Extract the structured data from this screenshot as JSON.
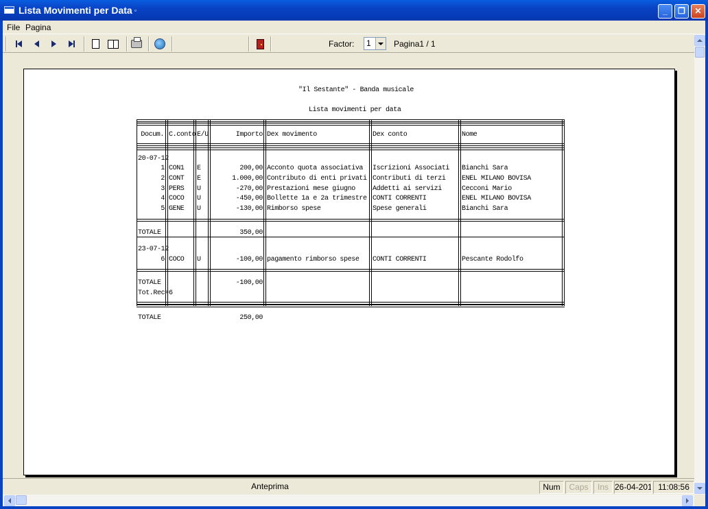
{
  "window": {
    "title": "Lista Movimenti per Data",
    "title_mark": "▫",
    "buttons": {
      "minimize": "_",
      "maximize": "❐",
      "close": "✕"
    }
  },
  "menu": {
    "items": [
      "File",
      "Pagina"
    ]
  },
  "toolbar": {
    "icons": [
      "first-page-icon",
      "previous-page-icon",
      "next-page-icon",
      "last-page-icon",
      "single-page-icon",
      "two-pages-icon",
      "print-icon",
      "export-icon",
      "exit-door-icon"
    ],
    "factor_label": "Factor:",
    "factor_value": "1",
    "page_info": "Pagina1 / 1"
  },
  "report": {
    "title": "\"Il Sestante\" - Banda musicale",
    "subtitle": "Lista movimenti per data",
    "headers": [
      "Docum.",
      "C.conto",
      "E/U",
      "Importo",
      "Dex movimento",
      "Dex conto",
      "Nome"
    ],
    "groups": [
      {
        "date": "20-07-12",
        "rows": [
          {
            "doc": "1",
            "conto": "CON1",
            "eu": "E",
            "importo": "200,00",
            "movimento": "Acconto quota associativa",
            "desc_conto": "Iscrizioni Associati",
            "nome": "Bianchi Sara"
          },
          {
            "doc": "2",
            "conto": "CONT",
            "eu": "E",
            "importo": "1.000,00",
            "movimento": "Contributo di enti privati",
            "desc_conto": "Contributi di terzi",
            "nome": "ENEL MILANO BOVISA"
          },
          {
            "doc": "3",
            "conto": "PERS",
            "eu": "U",
            "importo": "-270,00",
            "movimento": "Prestazioni mese giugno",
            "desc_conto": "Addetti ai servizi",
            "nome": "Cecconi Mario"
          },
          {
            "doc": "4",
            "conto": "COCO",
            "eu": "U",
            "importo": "-450,00",
            "movimento": "Bollette 1a e 2a trimestre",
            "desc_conto": "CONTI CORRENTI",
            "nome": "ENEL MILANO BOVISA"
          },
          {
            "doc": "5",
            "conto": "GENE",
            "eu": "U",
            "importo": "-130,00",
            "movimento": "Rimborso spese",
            "desc_conto": "Spese generali",
            "nome": "Bianchi Sara"
          }
        ],
        "total_label": "TOTALE",
        "total": "350,00"
      },
      {
        "date": "23-07-12",
        "rows": [
          {
            "doc": "6",
            "conto": "COCO",
            "eu": "U",
            "importo": "-100,00",
            "movimento": "pagamento rimborso spese",
            "desc_conto": "CONTI CORRENTI",
            "nome": "Pescante Rodolfo"
          }
        ],
        "total_label": "TOTALE",
        "total": "-100,00"
      }
    ],
    "tot_rec_label": "Tot.Rec=",
    "tot_rec_value": "6",
    "grand_total_label": "TOTALE",
    "grand_total": "250,00"
  },
  "status": {
    "main": "Anteprima",
    "num": "Num",
    "caps": "Caps",
    "ins": "Ins",
    "date": "26-04-2016",
    "time": "11:08:56"
  },
  "colors": {
    "titlebar": "#0843c4",
    "chrome": "#ece9d8",
    "close_button": "#cc4421"
  }
}
